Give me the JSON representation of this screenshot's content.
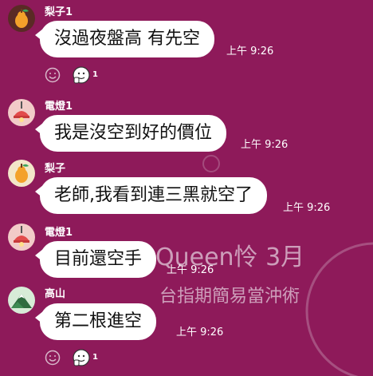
{
  "watermark": {
    "line1": "Queen怜  3月",
    "line2": "台指期簡易當沖術"
  },
  "messages": [
    {
      "sender": "梨子1",
      "avatar": "pear-avatar-icon",
      "text": "沒過夜盤高 有先空",
      "time": "上午 9:26",
      "reaction": {
        "count": "1",
        "emoji": "waving-face-icon"
      }
    },
    {
      "sender": "電燈1",
      "avatar": "lamp-avatar-icon",
      "text": "我是沒空到好的價位",
      "time": "上午 9:26"
    },
    {
      "sender": "梨子",
      "avatar": "pear-avatar-icon",
      "text": "老師,我看到連三黑就空了",
      "time": "上午 9:26"
    },
    {
      "sender": "電燈1",
      "avatar": "lamp-avatar-icon",
      "text": "目前還空手",
      "time": "上午 9:26"
    },
    {
      "sender": "高山",
      "avatar": "mountain-avatar-icon",
      "text": "第二根進空",
      "time": "上午 9:26",
      "reaction": {
        "count": "1",
        "emoji": "waving-face-icon"
      }
    }
  ],
  "colors": {
    "background": "#8e1a5a",
    "bubble": "#ffffff",
    "text": "#111111"
  }
}
